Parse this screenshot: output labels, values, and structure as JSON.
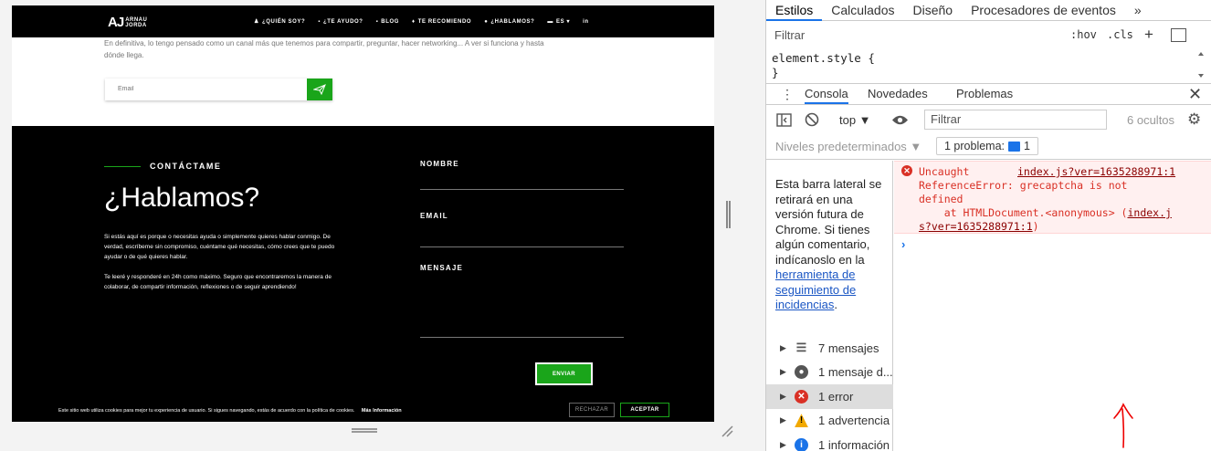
{
  "site": {
    "logo_mark": "AJ",
    "logo_line1": "ARNAU",
    "logo_line2": "JORDA",
    "nav": [
      {
        "icon": "person-icon",
        "glyph": "♟",
        "label": "¿QUIÉN SOY?"
      },
      {
        "icon": "chat-icon",
        "glyph": "▪",
        "label": "¿TE AYUDO?"
      },
      {
        "icon": "blog-icon",
        "glyph": "▪",
        "label": "BLOG"
      },
      {
        "icon": "thumbs-up-icon",
        "glyph": "♦",
        "label": "TE RECOMIENDO"
      },
      {
        "icon": "talk-icon",
        "glyph": "●",
        "label": "¿HABLAMOS?"
      },
      {
        "icon": "flag-icon",
        "glyph": "▬",
        "label": "ES ▾"
      },
      {
        "icon": "linkedin-icon",
        "glyph": "in",
        "label": ""
      }
    ],
    "intro_line1": "En definitiva, lo tengo pensado como un canal más que tenemos para compartir, preguntar, hacer networking... A ver si funciona y hasta",
    "intro_line2": "dónde llega.",
    "subscribe_placeholder": "Email",
    "contact": {
      "eyebrow": "CONTÁCTAME",
      "title": "¿Hablamos?",
      "p1": "Si estás aquí es porque o necesitas ayuda o simplemente quieres hablar conmigo. De verdad, escríbeme sin compromiso, cuéntame qué necesitas, cómo crees que te puedo ayudar o de qué quieres hablar.",
      "p2": "Te leeré y responderé en 24h como máximo. Seguro que encontraremos la manera de colaborar, de compartir información, reflexiones o de seguir aprendiendo!",
      "label_name": "NOMBRE",
      "label_email": "EMAIL",
      "label_message": "MENSAJE",
      "send": "ENVIAR"
    },
    "cookie": {
      "text": "Este sitio web utiliza cookies para mejor tu experiencia de usuario. Si sigues navegando, estás de acuerdo con la política de cookies.",
      "link": "Más Información",
      "reject": "RECHAZAR",
      "accept": "ACEPTAR"
    }
  },
  "devtools": {
    "tabs": [
      "Estilos",
      "Calculados",
      "Diseño",
      "Procesadores de eventos",
      "»"
    ],
    "filter_placeholder": "Filtrar",
    "hov": ":hov",
    "cls": ".cls",
    "style_line1": "element.style {",
    "style_line2": "}",
    "drawer_tabs": [
      "Consola",
      "Novedades",
      "Problemas"
    ],
    "context": "top ▼",
    "console_filter": "Filtrar",
    "hidden": "6 ocultos",
    "levels": "Niveles predeterminados ▼",
    "issues": "1 problema:",
    "issues_count": "1",
    "deprecation_text": "Esta barra lateral se retirará en una versión futura de Chrome. Si tienes algún comentario, indícanoslo en la ",
    "deprecation_link": "herramienta de seguimiento de incidencias",
    "deprecation_end": ".",
    "sidebar_items": [
      {
        "icon": "list-icon",
        "label": "7 mensajes"
      },
      {
        "icon": "user-icon",
        "label": "1 mensaje d..."
      },
      {
        "icon": "error-icon",
        "label": "1 error"
      },
      {
        "icon": "warning-icon",
        "label": "1 advertencia"
      },
      {
        "icon": "info-icon",
        "label": "1 información"
      }
    ],
    "error": {
      "line1": "Uncaught",
      "source": "index.js?ver=1635288971:1",
      "line2": "ReferenceError: grecaptcha is not",
      "line3": "defined",
      "line4_pre": "    at HTMLDocument.<anonymous> (",
      "line4_link": "index.j",
      "line5_link": "s?ver=1635288971:1",
      "line5_post": ")"
    },
    "prompt": "›",
    "colors": {
      "error": "#d93025",
      "accent": "#1a73e8",
      "brand_green": "#1aa51a"
    }
  }
}
